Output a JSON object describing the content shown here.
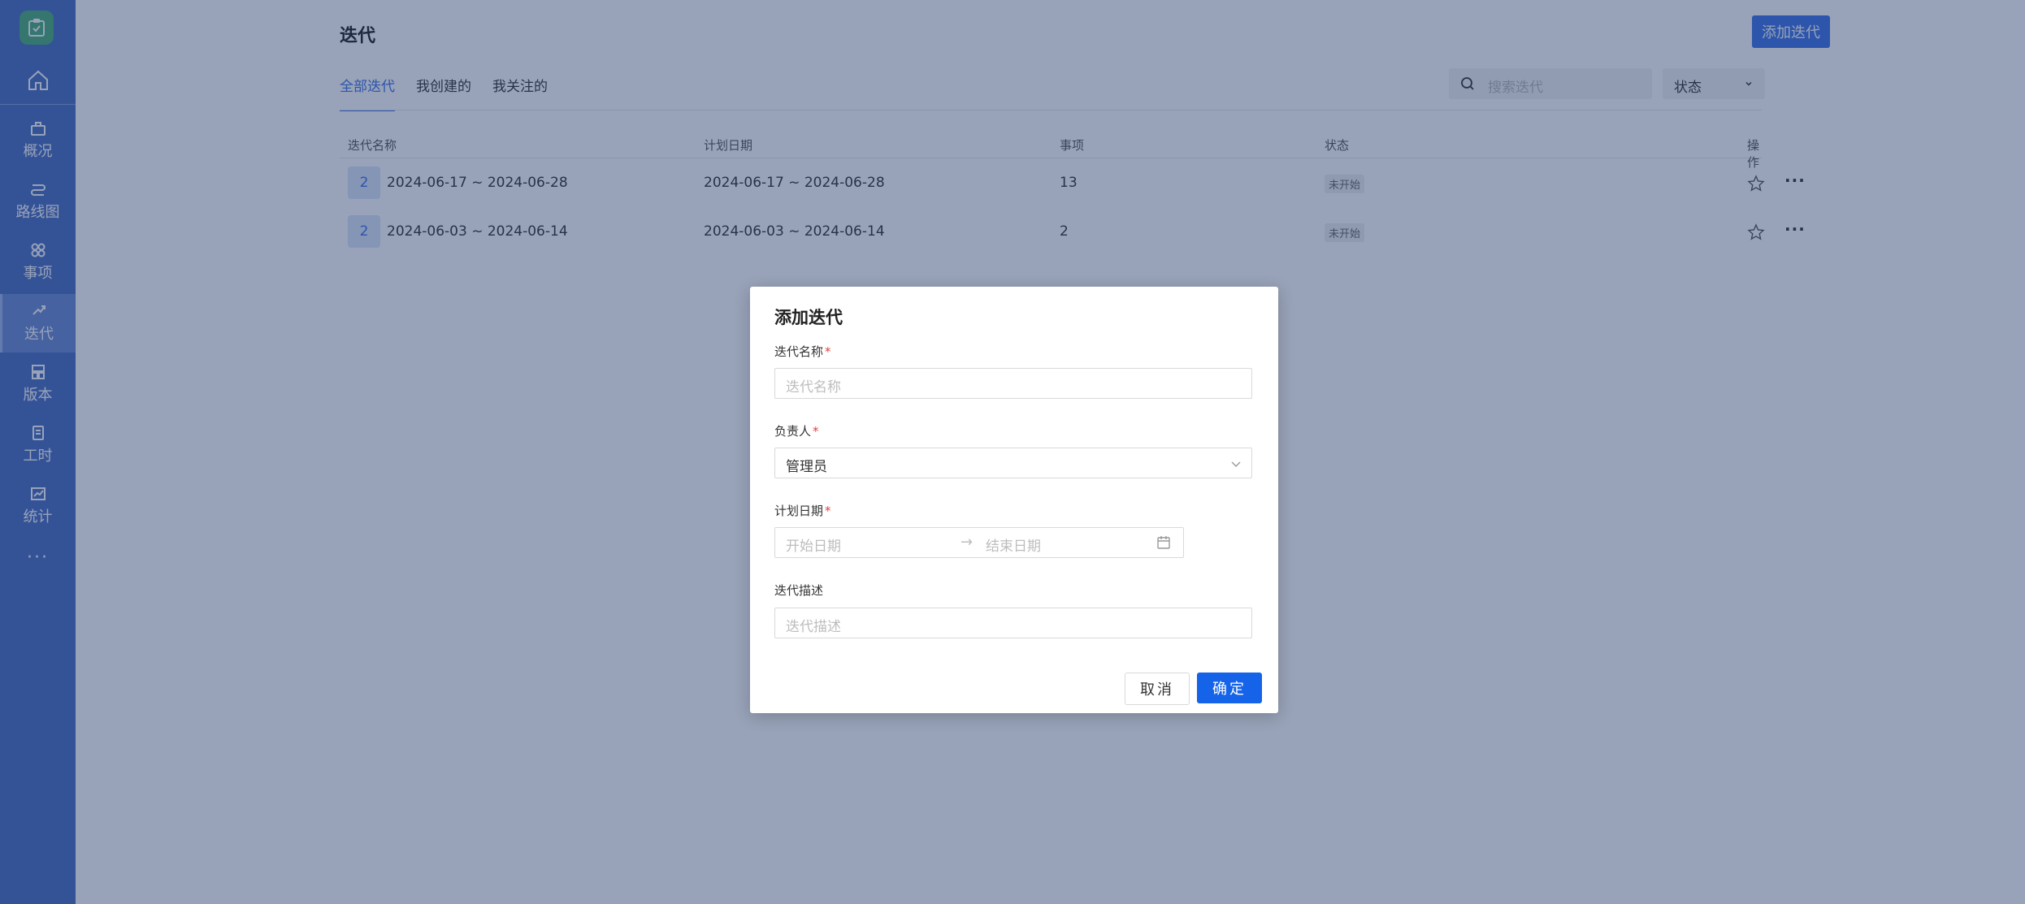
{
  "sidebar": {
    "items": [
      {
        "label": "概况",
        "icon": "briefcase-icon"
      },
      {
        "label": "路线图",
        "icon": "route-icon"
      },
      {
        "label": "事项",
        "icon": "items-icon"
      },
      {
        "label": "迭代",
        "icon": "iteration-icon",
        "active": true
      },
      {
        "label": "版本",
        "icon": "version-icon"
      },
      {
        "label": "工时",
        "icon": "timesheet-icon"
      },
      {
        "label": "统计",
        "icon": "chart-icon"
      }
    ],
    "more": "···"
  },
  "header": {
    "title": "迭代",
    "add_button": "添加迭代"
  },
  "tabs": [
    "全部迭代",
    "我创建的",
    "我关注的"
  ],
  "search": {
    "placeholder": "搜索迭代"
  },
  "status_filter": {
    "label": "状态"
  },
  "table": {
    "columns": [
      "迭代名称",
      "计划日期",
      "事项",
      "状态",
      "操作"
    ],
    "rows": [
      {
        "badge": "2",
        "name": "2024-06-17 ~ 2024-06-28",
        "date": "2024-06-17 ~ 2024-06-28",
        "items": "13",
        "status": "未开始"
      },
      {
        "badge": "2",
        "name": "2024-06-03 ~ 2024-06-14",
        "date": "2024-06-03 ~ 2024-06-14",
        "items": "2",
        "status": "未开始"
      }
    ]
  },
  "modal": {
    "title": "添加迭代",
    "name_label": "迭代名称",
    "name_placeholder": "迭代名称",
    "owner_label": "负责人",
    "owner_value": "管理员",
    "date_label": "计划日期",
    "start_placeholder": "开始日期",
    "end_placeholder": "结束日期",
    "desc_label": "迭代描述",
    "desc_placeholder": "迭代描述",
    "required_mark": "*",
    "cancel": "取消",
    "ok": "确定"
  },
  "colors": {
    "sidebar": "#4a6fc4",
    "primary": "#1463e8",
    "required": "#e53e3e"
  }
}
